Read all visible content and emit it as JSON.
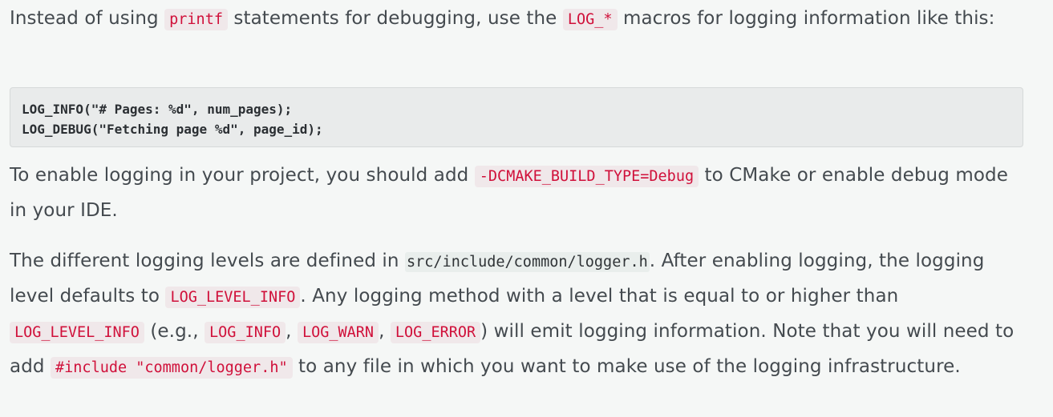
{
  "para1": {
    "t1": "Instead of using ",
    "c1": "printf",
    "t2": " statements for debugging, use the ",
    "c2": "LOG_*",
    "t3": " macros for logging information like this:"
  },
  "codeblock": {
    "line1": "LOG_INFO(\"# Pages: %d\", num_pages);",
    "line2": "LOG_DEBUG(\"Fetching page %d\", page_id);"
  },
  "para2": {
    "t1": "To enable logging in your project, you should add ",
    "c1": "-DCMAKE_BUILD_TYPE=Debug",
    "t2": " to CMake or enable debug mode in your IDE."
  },
  "para3": {
    "t1": "The different logging levels are defined in ",
    "path": "src/include/common/logger.h",
    "t2": ". After enabling logging, the logging level defaults to ",
    "c1": "LOG_LEVEL_INFO",
    "t3": ". Any logging method with a level that is equal to or higher than ",
    "c2": "LOG_LEVEL_INFO",
    "t4": " (e.g., ",
    "c3": "LOG_INFO",
    "t5": ", ",
    "c4": "LOG_WARN",
    "t6": ", ",
    "c5": "LOG_ERROR",
    "t7": ") will emit logging information. Note that you will need to add ",
    "c6": "#include \"common/logger.h\"",
    "t8": " to any file in which you want to make use of the logging infrastructure."
  }
}
